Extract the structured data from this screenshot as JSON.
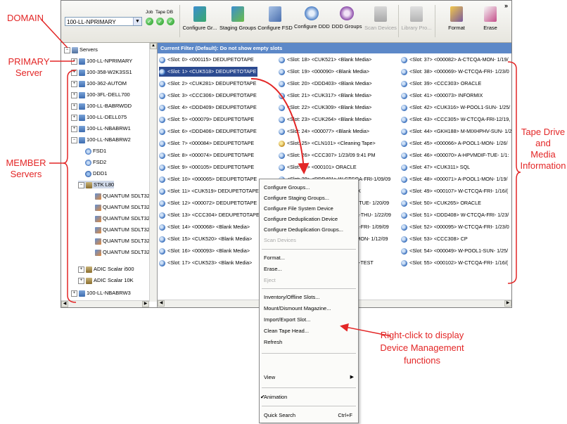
{
  "annotations": {
    "domain": "DOMAIN",
    "primary_line1": "PRIMARY",
    "primary_line2": "Server",
    "member_line1": "MEMBER",
    "member_line2": "Servers",
    "tape_line1": "Tape Drive",
    "tape_line2": "and",
    "tape_line3": "Media",
    "tape_line4": "Information",
    "rightclick_line1": "Right-click to display",
    "rightclick_line2": "Device Management",
    "rightclick_line3": "functions",
    "color": "#e32626"
  },
  "toolbar": {
    "server_combo": "100-LL-NPRIMARY",
    "status_labels": [
      "Job",
      "Tape",
      "DB"
    ],
    "buttons": [
      {
        "label": "Configure Gr...",
        "enabled": true,
        "icon": "configure-groups-icon"
      },
      {
        "label": "Staging Groups",
        "enabled": true,
        "icon": "staging-groups-icon"
      },
      {
        "label": "Configure FSD",
        "enabled": true,
        "icon": "configure-fsd-icon"
      },
      {
        "label": "Configure DDD",
        "enabled": true,
        "icon": "configure-ddd-icon"
      },
      {
        "label": "DDD Groups",
        "enabled": true,
        "icon": "ddd-groups-icon"
      },
      {
        "label": "Scan Devices",
        "enabled": false,
        "icon": "scan-devices-icon"
      },
      {
        "label": "Library Pro...",
        "enabled": false,
        "icon": "library-properties-icon"
      },
      {
        "label": "Format",
        "enabled": true,
        "icon": "format-icon"
      },
      {
        "label": "Erase",
        "enabled": true,
        "icon": "erase-icon"
      }
    ],
    "overflow": "»"
  },
  "tree": {
    "root": "Servers",
    "servers": [
      "100-LL-NPRIMARY",
      "100-358-W2K3SS1",
      "100-362-AUTOM",
      "100-3FL-DELL700",
      "100-LL-BABRWDD",
      "100-LL-DELL075",
      "100-LL-NBABRW1",
      "100-LL-NBABRW2"
    ],
    "children": [
      "FSD1",
      "FSD2",
      "DDD1",
      "STK L80"
    ],
    "drives": [
      "QUANTUM SDLT32(",
      "QUANTUM SDLT32(",
      "QUANTUM SDLT32(",
      "QUANTUM SDLT32(",
      "QUANTUM SDLT32(",
      "QUANTUM SDLT32("
    ],
    "libraries": [
      "ADIC Scalar i500",
      "ADIC Scalar 10K"
    ],
    "last_server": "100-LL-NBABRW3"
  },
  "filter": "Current Filter (Default):   Do not show empty slots",
  "slots": {
    "col1": [
      "<Slot: 0> <000115> DEDUPETOTAPE",
      "<Slot: 1> <CUK518> DEDUPETOTAPE",
      "<Slot: 2> <CUK281> DEDUPETOTAPE",
      "<Slot: 3> <CCC306> DEDUPETOTAPE",
      "<Slot: 4> <DDD409> DEDUPETOTAPE",
      "<Slot: 5> <000079> DEDUPETOTAPE",
      "<Slot: 6> <DDD406> DEDUPETOTAPE",
      "<Slot: 7> <000084> DEDUPETOTAPE",
      "<Slot: 8> <000074> DEDUPETOTAPE",
      "<Slot: 9> <000105> DEDUPETOTAPE",
      "<Slot: 10> <000065> DEDUPETOTAPE",
      "<Slot: 11> <CUK519> DEDUPETOTAPE",
      "<Slot: 12> <000072> DEDUPETOTAPE",
      "<Slot: 13> <CCC304> DEDUPETOTAPE",
      "<Slot: 14> <000068> <Blank Media>",
      "<Slot: 15> <CUK520> <Blank Media>",
      "<Slot: 16> <000093> <Blank Media>",
      "<Slot: 17> <CUK523> <Blank Media>"
    ],
    "col2": [
      "<Slot: 18> <CUK521> <Blank Media>",
      "<Slot: 19> <000090> <Blank Media>",
      "<Slot: 20> <DDD403> <Blank Media>",
      "<Slot: 21> <CUK317> <Blank Media>",
      "<Slot: 22> <CUK309> <Blank Media>",
      "<Slot: 23> <CUK264> <Blank Media>",
      "<Slot: 24> <000077> <Blank Media>",
      "<Slot: 25> <CLN101> <Cleaning Tape>",
      "<Slot: 26> <CCC307> 1/23/09 9:41 PM",
      "<Slot: 27> <000101> ORACLE",
      "<Slot: 28> <DDD401> W-CTCQA-FRI-1/09/09",
      "MIX",
      "L1-TUE- 1/20/09",
      "QA-THU- 1/22/09",
      "QA-FRI- 1/09/09",
      "1-MON- 1/12/09",
      "",
      "RE-TEST"
    ],
    "col3": [
      "<Slot: 37> <000082> A-CTCQA-MON- 1/19/",
      "<Slot: 38> <000069> W-CTCQA-FRI- 1/23/0",
      "<Slot: 39> <CCC303> ORACLE",
      "<Slot: 41> <000073> INFORMIX",
      "<Slot: 42> <CUK316> W-POOL1-SUN- 1/25/",
      "<Slot: 43> <CCC305> W-CTCQA-FRI-12/19,",
      "<Slot: 44> <GKH188> M-MIXHPHV-SUN- 1/2",
      "<Slot: 45> <000066> A-POOL1-MON- 1/26/",
      "<Slot: 46> <000070> A-HPVMDIF-TUE- 1/1:",
      "<Slot: 47> <CUK311> SQL",
      "<Slot: 48> <000071> A-POOL1-MON- 1/19/",
      "<Slot: 49> <000107> W-CTCQA-FRI- 1/16/(",
      "<Slot: 50> <CUK265> ORACLE",
      "<Slot: 51> <DDD408> W-CTCQA-FRI- 1/23/",
      "<Slot: 52> <000095> W-CTCQA-FRI- 1/23/0",
      "<Slot: 53> <CCC308> CP",
      "<Slot: 54> <000049> W-POOL1-SUN- 1/25/",
      "<Slot: 55> <000102> W-CTCQA-FRI- 1/16/("
    ]
  },
  "context_menu": {
    "group1": [
      "Configure Groups...",
      "Configure Staging Groups...",
      "Configure File System Device",
      "Configure Deduplication Device",
      "Configure Deduplication Groups..."
    ],
    "scan": "Scan Devices",
    "group2": [
      "Format...",
      "Erase..."
    ],
    "eject": "Eject",
    "group3": [
      "Inventory/Offline Slots...",
      "Mount/Dismount Magazine...",
      "Import/Export Slot...",
      "Clean Tape Head...",
      "Refresh"
    ],
    "view": "View",
    "animation": "Animation",
    "quick_search": "Quick Search",
    "quick_search_shortcut": "Ctrl+F"
  }
}
